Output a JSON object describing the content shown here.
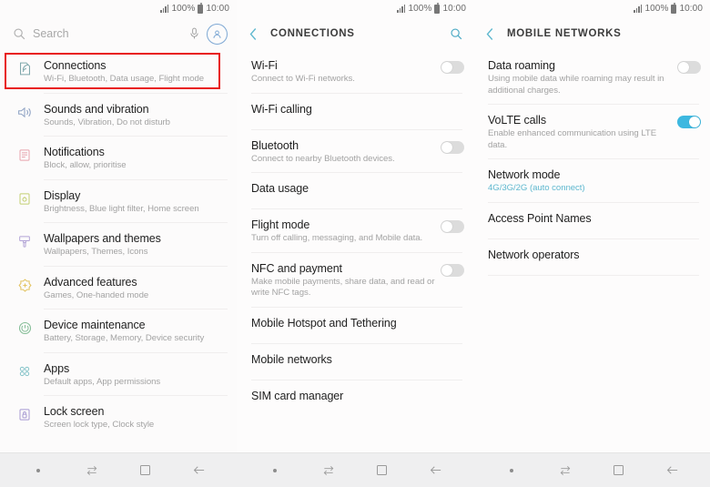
{
  "status_bar": {
    "signal_icon": "signal-bars-icon",
    "battery_percent": "100%",
    "battery_icon": "battery-full-icon",
    "time": "10:00"
  },
  "colors": {
    "accent_teal": "#5fb8cf",
    "toggle_on": "#3db8e0",
    "highlight_red": "#e81a1a",
    "avatar_blue": "#7ea8d4"
  },
  "panel_settings": {
    "search": {
      "icon": "search-icon",
      "placeholder": "Search",
      "mic_icon": "microphone-icon",
      "avatar_icon": "account-avatar-icon"
    },
    "items": [
      {
        "title": "Connections",
        "subtitle": "Wi-Fi, Bluetooth, Data usage, Flight mode",
        "icon": "connections-icon",
        "highlighted": true
      },
      {
        "title": "Sounds and vibration",
        "subtitle": "Sounds, Vibration, Do not disturb",
        "icon": "sound-speaker-icon",
        "highlighted": false
      },
      {
        "title": "Notifications",
        "subtitle": "Block, allow, prioritise",
        "icon": "notifications-icon",
        "highlighted": false
      },
      {
        "title": "Display",
        "subtitle": "Brightness, Blue light filter, Home screen",
        "icon": "display-icon",
        "highlighted": false
      },
      {
        "title": "Wallpapers and themes",
        "subtitle": "Wallpapers, Themes, Icons",
        "icon": "wallpaper-brush-icon",
        "highlighted": false
      },
      {
        "title": "Advanced features",
        "subtitle": "Games, One-handed mode",
        "icon": "advanced-features-icon",
        "highlighted": false
      },
      {
        "title": "Device maintenance",
        "subtitle": "Battery, Storage, Memory, Device security",
        "icon": "device-maintenance-icon",
        "highlighted": false
      },
      {
        "title": "Apps",
        "subtitle": "Default apps, App permissions",
        "icon": "apps-grid-icon",
        "highlighted": false
      },
      {
        "title": "Lock screen",
        "subtitle": "Screen lock type, Clock style",
        "icon": "lock-screen-icon",
        "highlighted": false
      }
    ]
  },
  "panel_connections": {
    "header": {
      "back_icon": "back-chevron-icon",
      "title": "CONNECTIONS",
      "search_icon": "search-icon"
    },
    "items": [
      {
        "title": "Wi-Fi",
        "subtitle": "Connect to Wi-Fi networks.",
        "toggle": "off",
        "highlighted": false
      },
      {
        "title": "Wi-Fi calling",
        "subtitle": "",
        "toggle": "none",
        "highlighted": false
      },
      {
        "title": "Bluetooth",
        "subtitle": "Connect to nearby Bluetooth devices.",
        "toggle": "off",
        "highlighted": false
      },
      {
        "title": "Data usage",
        "subtitle": "",
        "toggle": "none",
        "highlighted": false
      },
      {
        "title": "Flight mode",
        "subtitle": "Turn off calling, messaging, and Mobile data.",
        "toggle": "off",
        "highlighted": false
      },
      {
        "title": "NFC and payment",
        "subtitle": "Make mobile payments, share data, and read or write NFC tags.",
        "toggle": "off",
        "highlighted": false
      },
      {
        "title": "Mobile Hotspot and Tethering",
        "subtitle": "",
        "toggle": "none",
        "highlighted": false
      },
      {
        "title": "Mobile networks",
        "subtitle": "",
        "toggle": "none",
        "highlighted": true
      },
      {
        "title": "SIM card manager",
        "subtitle": "",
        "toggle": "none",
        "highlighted": false
      }
    ]
  },
  "panel_mobile_networks": {
    "header": {
      "back_icon": "back-chevron-icon",
      "title": "MOBILE NETWORKS"
    },
    "items": [
      {
        "title": "Data roaming",
        "subtitle": "Using mobile data while roaming may result in additional charges.",
        "toggle": "off",
        "accent_sub": false,
        "highlighted": false
      },
      {
        "title": "VoLTE calls",
        "subtitle": "Enable enhanced communication using LTE data.",
        "toggle": "on",
        "accent_sub": false,
        "highlighted": false
      },
      {
        "title": "Network mode",
        "subtitle": "4G/3G/2G (auto connect)",
        "toggle": "none",
        "accent_sub": true,
        "highlighted": true
      },
      {
        "title": "Access Point Names",
        "subtitle": "",
        "toggle": "none",
        "accent_sub": false,
        "highlighted": false
      },
      {
        "title": "Network operators",
        "subtitle": "",
        "toggle": "none",
        "accent_sub": false,
        "highlighted": false
      }
    ]
  },
  "bottom_nav": {
    "buttons": [
      {
        "icon": "menu-dot-icon"
      },
      {
        "icon": "recents-swap-icon"
      },
      {
        "icon": "home-square-icon"
      },
      {
        "icon": "back-arrow-icon"
      }
    ]
  }
}
